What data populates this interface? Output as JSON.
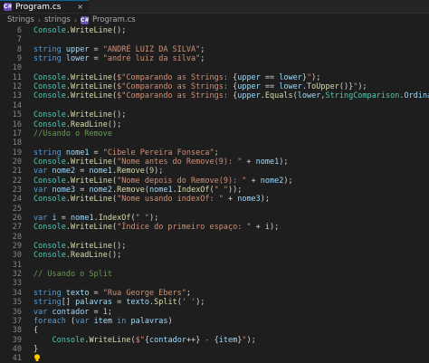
{
  "tab": {
    "icon": "C#",
    "title": "Program.cs",
    "close": "×"
  },
  "breadcrumb": [
    "Strings",
    "strings",
    "Program.cs"
  ],
  "code_lines": [
    {
      "n": "6",
      "tokens": [
        [
          "cl",
          "Console"
        ],
        [
          "pun",
          "."
        ],
        [
          "fn",
          "WriteLine"
        ],
        [
          "pun",
          "();"
        ]
      ]
    },
    {
      "n": "7",
      "tokens": []
    },
    {
      "n": "8",
      "tokens": [
        [
          "kw",
          "string"
        ],
        [
          "pun",
          " "
        ],
        [
          "var",
          "upper"
        ],
        [
          "pun",
          " = "
        ],
        [
          "str",
          "\"ANDRÉ LUIZ DA SILVA\""
        ],
        [
          "pun",
          ";"
        ]
      ]
    },
    {
      "n": "9",
      "tokens": [
        [
          "kw",
          "string"
        ],
        [
          "pun",
          " "
        ],
        [
          "var",
          "lower"
        ],
        [
          "pun",
          " = "
        ],
        [
          "str",
          "\"andré luiz da silva\""
        ],
        [
          "pun",
          ";"
        ]
      ]
    },
    {
      "n": "10",
      "tokens": []
    },
    {
      "n": "11",
      "tokens": [
        [
          "cl",
          "Console"
        ],
        [
          "pun",
          "."
        ],
        [
          "fn",
          "WriteLine"
        ],
        [
          "pun",
          "("
        ],
        [
          "str",
          "$\"Comparando as Strings: "
        ],
        [
          "pun",
          "{"
        ],
        [
          "var",
          "upper"
        ],
        [
          "pun",
          " == "
        ],
        [
          "var",
          "lower"
        ],
        [
          "pun",
          "}"
        ],
        [
          "str",
          "\""
        ],
        [
          "pun",
          ");"
        ]
      ]
    },
    {
      "n": "12",
      "tokens": [
        [
          "cl",
          "Console"
        ],
        [
          "pun",
          "."
        ],
        [
          "fn",
          "WriteLine"
        ],
        [
          "pun",
          "("
        ],
        [
          "str",
          "$\"Comparando as Strings: "
        ],
        [
          "pun",
          "{"
        ],
        [
          "var",
          "upper"
        ],
        [
          "pun",
          " == "
        ],
        [
          "var",
          "lower"
        ],
        [
          "pun",
          "."
        ],
        [
          "fn",
          "ToUpper"
        ],
        [
          "pun",
          "()}"
        ],
        [
          "str",
          "\""
        ],
        [
          "pun",
          ");"
        ]
      ]
    },
    {
      "n": "13",
      "tokens": [
        [
          "cl",
          "Console"
        ],
        [
          "pun",
          "."
        ],
        [
          "fn",
          "WriteLine"
        ],
        [
          "pun",
          "("
        ],
        [
          "str",
          "$\"Comparando as Strings: "
        ],
        [
          "pun",
          "{"
        ],
        [
          "var",
          "upper"
        ],
        [
          "pun",
          "."
        ],
        [
          "fn",
          "Equals"
        ],
        [
          "pun",
          "("
        ],
        [
          "var",
          "lower"
        ],
        [
          "pun",
          ","
        ],
        [
          "cl",
          "StringComparison"
        ],
        [
          "pun",
          "."
        ],
        [
          "var",
          "OrdinalIgnoreCase"
        ],
        [
          "pun",
          ")}"
        ],
        [
          "str",
          "\""
        ],
        [
          "pun",
          ");"
        ]
      ]
    },
    {
      "n": "14",
      "tokens": []
    },
    {
      "n": "15",
      "tokens": [
        [
          "cl",
          "Console"
        ],
        [
          "pun",
          "."
        ],
        [
          "fn",
          "WriteLine"
        ],
        [
          "pun",
          "();"
        ]
      ]
    },
    {
      "n": "16",
      "tokens": [
        [
          "cl",
          "Console"
        ],
        [
          "pun",
          "."
        ],
        [
          "fn",
          "ReadLine"
        ],
        [
          "pun",
          "();"
        ]
      ]
    },
    {
      "n": "17",
      "tokens": [
        [
          "cm",
          "//Usando o Remove"
        ]
      ]
    },
    {
      "n": "18",
      "tokens": []
    },
    {
      "n": "19",
      "tokens": [
        [
          "kw",
          "string"
        ],
        [
          "pun",
          " "
        ],
        [
          "var",
          "nome1"
        ],
        [
          "pun",
          " = "
        ],
        [
          "str",
          "\"Cibele Pereira Fonseca\""
        ],
        [
          "pun",
          ";"
        ]
      ]
    },
    {
      "n": "20",
      "tokens": [
        [
          "cl",
          "Console"
        ],
        [
          "pun",
          "."
        ],
        [
          "fn",
          "WriteLine"
        ],
        [
          "pun",
          "("
        ],
        [
          "str",
          "\"Nome antes do Remove(9): \""
        ],
        [
          "pun",
          " + "
        ],
        [
          "var",
          "nome1"
        ],
        [
          "pun",
          ");"
        ]
      ]
    },
    {
      "n": "21",
      "tokens": [
        [
          "kw",
          "var"
        ],
        [
          "pun",
          " "
        ],
        [
          "var",
          "nome2"
        ],
        [
          "pun",
          " = "
        ],
        [
          "var",
          "nome1"
        ],
        [
          "pun",
          "."
        ],
        [
          "fn",
          "Remove"
        ],
        [
          "pun",
          "("
        ],
        [
          "num",
          "9"
        ],
        [
          "pun",
          ");"
        ]
      ]
    },
    {
      "n": "22",
      "tokens": [
        [
          "cl",
          "Console"
        ],
        [
          "pun",
          "."
        ],
        [
          "fn",
          "WriteLine"
        ],
        [
          "pun",
          "("
        ],
        [
          "str",
          "\"Nome depois do Remove(9): \""
        ],
        [
          "pun",
          " + "
        ],
        [
          "var",
          "nome2"
        ],
        [
          "pun",
          ");"
        ]
      ]
    },
    {
      "n": "23",
      "tokens": [
        [
          "kw",
          "var"
        ],
        [
          "pun",
          " "
        ],
        [
          "var",
          "nome3"
        ],
        [
          "pun",
          " = "
        ],
        [
          "var",
          "nome2"
        ],
        [
          "pun",
          "."
        ],
        [
          "fn",
          "Remove"
        ],
        [
          "pun",
          "("
        ],
        [
          "var",
          "nome1"
        ],
        [
          "pun",
          "."
        ],
        [
          "fn",
          "IndexOf"
        ],
        [
          "pun",
          "("
        ],
        [
          "str",
          "\" \""
        ],
        [
          "pun",
          "));"
        ]
      ]
    },
    {
      "n": "24",
      "tokens": [
        [
          "cl",
          "Console"
        ],
        [
          "pun",
          "."
        ],
        [
          "fn",
          "WriteLine"
        ],
        [
          "pun",
          "("
        ],
        [
          "str",
          "\"Nome usando indexOf: \""
        ],
        [
          "pun",
          " + "
        ],
        [
          "var",
          "nome3"
        ],
        [
          "pun",
          ");"
        ]
      ]
    },
    {
      "n": "25",
      "tokens": []
    },
    {
      "n": "26",
      "tokens": [
        [
          "kw",
          "var"
        ],
        [
          "pun",
          " "
        ],
        [
          "var",
          "i"
        ],
        [
          "pun",
          " = "
        ],
        [
          "var",
          "nome1"
        ],
        [
          "pun",
          "."
        ],
        [
          "fn",
          "IndexOf"
        ],
        [
          "pun",
          "("
        ],
        [
          "str",
          "\" \""
        ],
        [
          "pun",
          ");"
        ]
      ]
    },
    {
      "n": "27",
      "tokens": [
        [
          "cl",
          "Console"
        ],
        [
          "pun",
          "."
        ],
        [
          "fn",
          "WriteLine"
        ],
        [
          "pun",
          "("
        ],
        [
          "str",
          "\"Índice do primeiro espaço: \""
        ],
        [
          "pun",
          " + "
        ],
        [
          "var",
          "i"
        ],
        [
          "pun",
          ");"
        ]
      ]
    },
    {
      "n": "28",
      "tokens": []
    },
    {
      "n": "29",
      "tokens": [
        [
          "cl",
          "Console"
        ],
        [
          "pun",
          "."
        ],
        [
          "fn",
          "WriteLine"
        ],
        [
          "pun",
          "();"
        ]
      ]
    },
    {
      "n": "30",
      "tokens": [
        [
          "cl",
          "Console"
        ],
        [
          "pun",
          "."
        ],
        [
          "fn",
          "ReadLine"
        ],
        [
          "pun",
          "();"
        ]
      ]
    },
    {
      "n": "31",
      "tokens": []
    },
    {
      "n": "32",
      "tokens": [
        [
          "cm",
          "// Usando o Split"
        ]
      ]
    },
    {
      "n": "33",
      "tokens": []
    },
    {
      "n": "34",
      "tokens": [
        [
          "kw",
          "string"
        ],
        [
          "pun",
          " "
        ],
        [
          "var",
          "texto"
        ],
        [
          "pun",
          " = "
        ],
        [
          "str",
          "\"Rua George Ebers\""
        ],
        [
          "pun",
          ";"
        ]
      ]
    },
    {
      "n": "35",
      "tokens": [
        [
          "kw",
          "string"
        ],
        [
          "pun",
          "[] "
        ],
        [
          "var",
          "palavras"
        ],
        [
          "pun",
          " = "
        ],
        [
          "var",
          "texto"
        ],
        [
          "pun",
          "."
        ],
        [
          "fn",
          "Split"
        ],
        [
          "pun",
          "("
        ],
        [
          "str",
          "' '"
        ],
        [
          "pun",
          ");"
        ]
      ]
    },
    {
      "n": "36",
      "tokens": [
        [
          "kw",
          "var"
        ],
        [
          "pun",
          " "
        ],
        [
          "var",
          "contador"
        ],
        [
          "pun",
          " = "
        ],
        [
          "num",
          "1"
        ],
        [
          "pun",
          ";"
        ]
      ]
    },
    {
      "n": "37",
      "tokens": [
        [
          "kw",
          "foreach"
        ],
        [
          "pun",
          " ("
        ],
        [
          "kw",
          "var"
        ],
        [
          "pun",
          " "
        ],
        [
          "var",
          "item"
        ],
        [
          "pun",
          " "
        ],
        [
          "kw",
          "in"
        ],
        [
          "pun",
          " "
        ],
        [
          "var",
          "palavras"
        ],
        [
          "pun",
          ")"
        ]
      ]
    },
    {
      "n": "38",
      "tokens": [
        [
          "pun",
          "{"
        ]
      ]
    },
    {
      "n": "39",
      "tokens": [
        [
          "pun",
          "    "
        ],
        [
          "cl",
          "Console"
        ],
        [
          "pun",
          "."
        ],
        [
          "fn",
          "WriteLine"
        ],
        [
          "pun",
          "("
        ],
        [
          "str",
          "$\""
        ],
        [
          "pun",
          "{"
        ],
        [
          "var",
          "contador"
        ],
        [
          "pun",
          "++}"
        ],
        [
          "str",
          " - "
        ],
        [
          "pun",
          "{"
        ],
        [
          "var",
          "item"
        ],
        [
          "pun",
          "}"
        ],
        [
          "str",
          "\""
        ],
        [
          "pun",
          ");"
        ]
      ]
    },
    {
      "n": "40",
      "tokens": [
        [
          "pun",
          "}"
        ]
      ]
    },
    {
      "n": "41",
      "tokens": []
    }
  ],
  "colors": {
    "background": "#1e1e1e",
    "keyword": "#569cd6",
    "class": "#4ec9b0",
    "function": "#dcdcaa",
    "string": "#ce9178",
    "variable": "#9cdcfe",
    "comment": "#6a9955",
    "number": "#b5cea8"
  }
}
